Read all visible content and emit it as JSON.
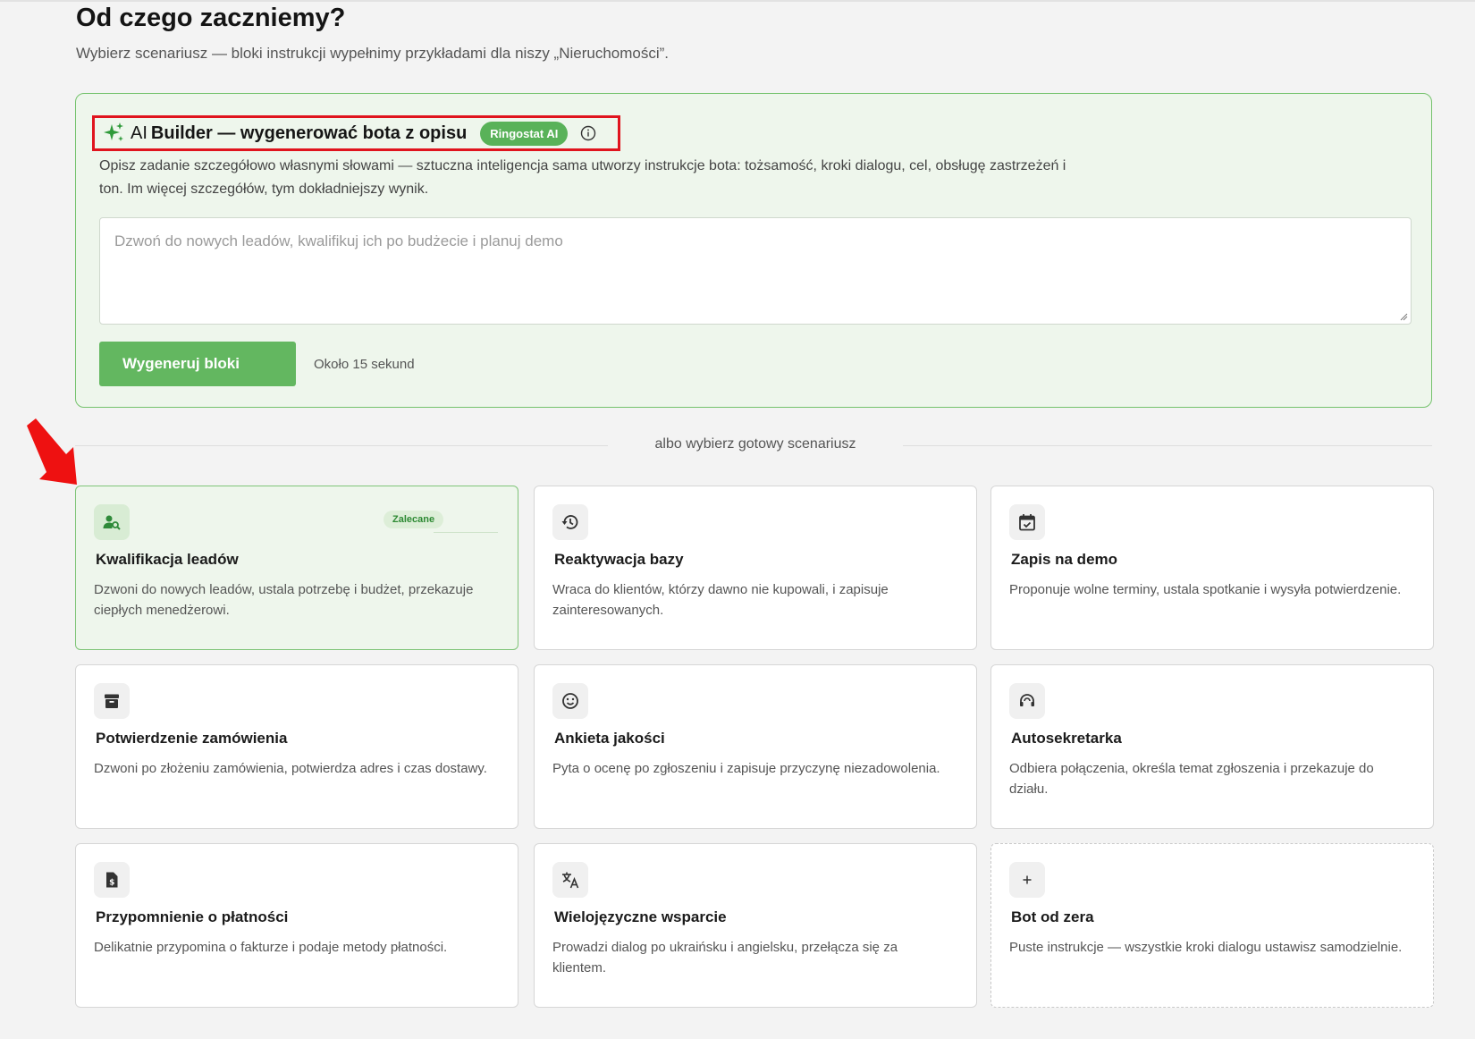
{
  "header": {
    "title": "Od czego zaczniemy?",
    "subtitle": "Wybierz scenariusz — bloki instrukcji wypełnimy przykładami dla niszy „Nieruchomości”."
  },
  "ai_builder": {
    "title_prefix": "AI",
    "title": "Builder — wygenerować bota z opisu",
    "badge": "Ringostat AI",
    "description": "Opisz zadanie szczegółowo własnymi słowami — sztuczna inteligencja sama utworzy instrukcje bota: tożsamość, kroki dialogu, cel, obsługę zastrzeżeń i ton. Im więcej szczegółów, tym dokładniejszy wynik.",
    "textarea_placeholder": "Dzwoń do nowych leadów, kwalifikuj ich po budżecie i planuj demo",
    "button_label": "Wygeneruj bloki",
    "hint": "Około 15 sekund",
    "accent_color": "#63b760"
  },
  "divider_text": "albo wybierz gotowy scenariusz",
  "scenarios": [
    {
      "title": "Kwalifikacja leadów",
      "description": "Dzwoni do nowych leadów, ustala potrzebę i budżet, przekazuje ciepłych menedżerowi.",
      "icon": "user-search-icon",
      "badge": "Zalecane",
      "selected": true
    },
    {
      "title": "Reaktywacja bazy",
      "description": "Wraca do klientów, którzy dawno nie kupowali, i zapisuje zainteresowanych.",
      "icon": "history-icon"
    },
    {
      "title": "Zapis na demo",
      "description": "Proponuje wolne terminy, ustala spotkanie i wysyła potwierdzenie.",
      "icon": "calendar-check-icon"
    },
    {
      "title": "Potwierdzenie zamówienia",
      "description": "Dzwoni po złożeniu zamówienia, potwierdza adres i czas dostawy.",
      "icon": "archive-box-icon"
    },
    {
      "title": "Ankieta jakości",
      "description": "Pyta o ocenę po zgłoszeniu i zapisuje przyczynę niezadowolenia.",
      "icon": "smiley-icon"
    },
    {
      "title": "Autosekretarka",
      "description": "Odbiera połączenia, określa temat zgłoszenia i przekazuje do działu.",
      "icon": "headset-icon"
    },
    {
      "title": "Przypomnienie o płatności",
      "description": "Delikatnie przypomina o fakturze i podaje metody płatności.",
      "icon": "invoice-dollar-icon"
    },
    {
      "title": "Wielojęzyczne wsparcie",
      "description": "Prowadzi dialog po ukraińsku i angielsku, przełącza się za klientem.",
      "icon": "translate-icon"
    },
    {
      "title": "Bot od zera",
      "description": "Puste instrukcje — wszystkie kroki dialogu ustawisz samodzielnie.",
      "icon": "plus-icon",
      "dashed": true
    }
  ]
}
